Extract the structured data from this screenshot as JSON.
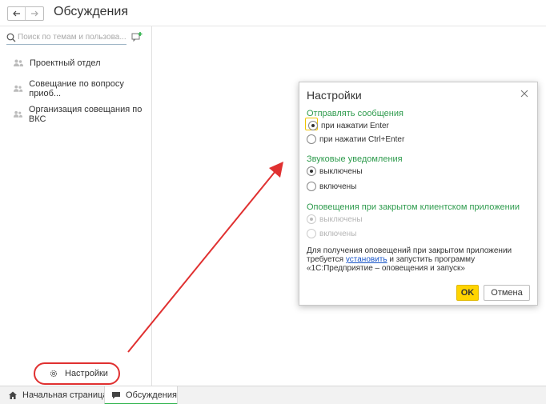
{
  "header": {
    "back_icon": "arrow-left-icon",
    "forward_icon": "arrow-right-icon",
    "title": "Обсуждения"
  },
  "sidebar": {
    "search": {
      "placeholder": "Поиск по темам и пользова...",
      "value": ""
    },
    "add_chat_icon": "add-conversation-icon",
    "conversations": [
      {
        "label": "Проектный отдел",
        "icon": "users-icon"
      },
      {
        "label": "Совещание по вопросу приоб...",
        "icon": "users-icon"
      },
      {
        "label": "Организация совещания по ВКС",
        "icon": "users-icon"
      }
    ],
    "settings": {
      "label": "Настройки",
      "icon": "gear-icon"
    }
  },
  "taskbar": {
    "tabs": [
      {
        "label": "Начальная страница",
        "icon": "home-icon"
      },
      {
        "label": "Обсуждения",
        "icon": "chat-icon",
        "active": true
      }
    ]
  },
  "dialog": {
    "title": "Настройки",
    "close_icon": "close-icon",
    "send_section": {
      "label": "Отправлять сообщения",
      "options": [
        {
          "label": "при нажатии Enter",
          "checked": true
        },
        {
          "label": "при нажатии Ctrl+Enter",
          "checked": false
        }
      ]
    },
    "sound_section": {
      "label": "Звуковые уведомления",
      "options": [
        {
          "label": "выключены",
          "checked": true
        },
        {
          "label": "включены",
          "checked": false
        }
      ]
    },
    "closed_section": {
      "label": "Оповещения при закрытом клиентском приложении",
      "options": [
        {
          "label": "выключены",
          "checked": true,
          "disabled": true
        },
        {
          "label": "включены",
          "checked": false,
          "disabled": true
        }
      ]
    },
    "info": {
      "line1": "Для получения оповещений при закрытом приложении",
      "line2_before": "требуется ",
      "link": "установить",
      "line2_after": " и запустить программу",
      "line3": "«1С:Предприятие – оповещения и запуск»"
    },
    "ok_label": "OK",
    "cancel_label": "Отмена"
  },
  "colors": {
    "accent_green": "#2e9b4d",
    "ok_yellow": "#ffd400",
    "annotation_red": "#e03030",
    "link_blue": "#1a56c8"
  }
}
